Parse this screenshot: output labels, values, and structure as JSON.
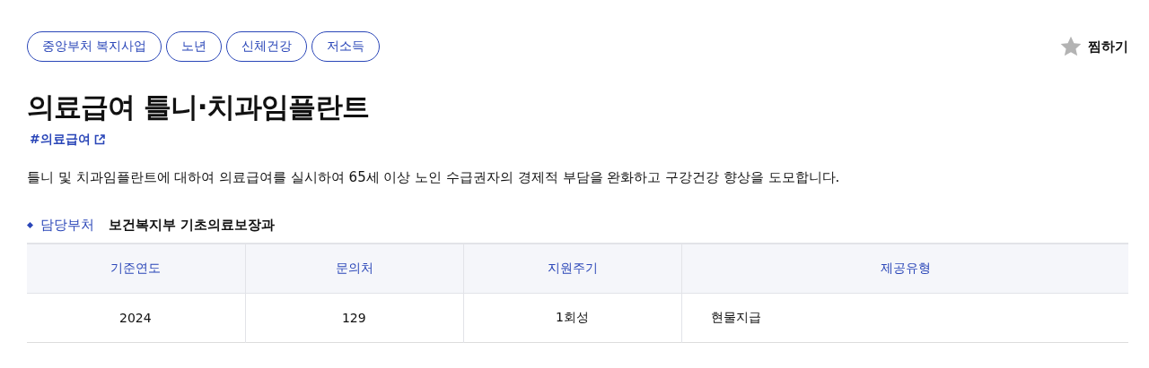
{
  "tags": [
    "중앙부처 복지사업",
    "노년",
    "신체건강",
    "저소득"
  ],
  "favorite": {
    "label": "찜하기"
  },
  "title": "의료급여 틀니·치과임플란트",
  "hashtag": "#의료급여",
  "description": "틀니 및 치과임플란트에 대하여 의료급여를 실시하여 65세 이상 노인 수급권자의 경제적 부담을 완화하고 구강건강 향상을 도모합니다.",
  "department": {
    "label": "담당부처",
    "value": "보건복지부 기초의료보장과"
  },
  "table": {
    "columns": [
      "기준연도",
      "문의처",
      "지원주기",
      "제공유형"
    ],
    "rows": [
      [
        "2024",
        "129",
        "1회성",
        "현물지급"
      ]
    ]
  }
}
